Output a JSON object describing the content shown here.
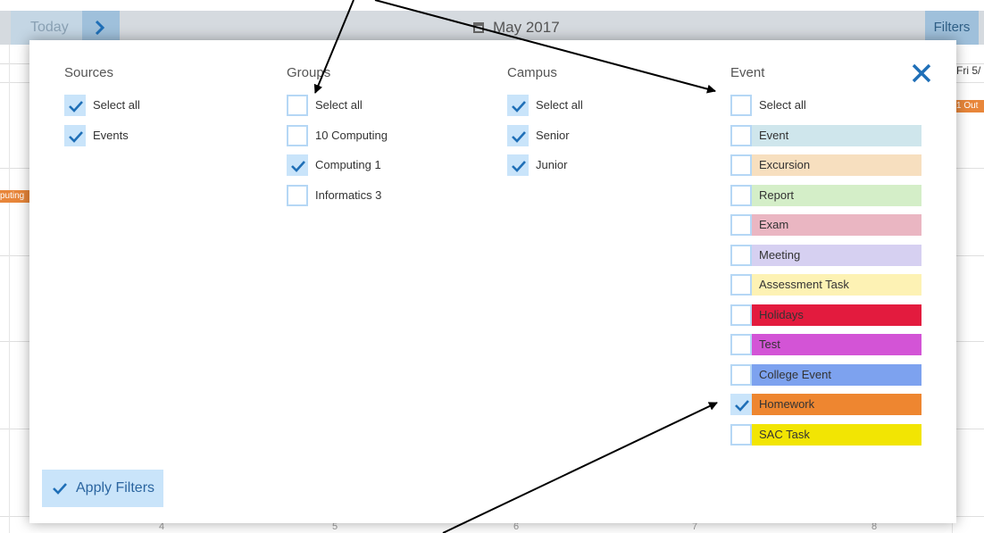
{
  "calendar": {
    "today_label": "Today",
    "month_title": "May 2017",
    "filters_label": "Filters",
    "fri_header": "Fri 5/",
    "chip_right": "1 Out",
    "chip_left": "puting",
    "day_numbers": [
      "4",
      "5",
      "6",
      "7",
      "8"
    ]
  },
  "modal": {
    "apply_label": "Apply Filters",
    "sources": {
      "title": "Sources",
      "options": [
        {
          "label": "Select all",
          "checked": true
        },
        {
          "label": "Events",
          "checked": true
        }
      ]
    },
    "groups": {
      "title": "Groups",
      "options": [
        {
          "label": "Select all",
          "checked": false
        },
        {
          "label": "10 Computing",
          "checked": false
        },
        {
          "label": "Computing 1",
          "checked": true
        },
        {
          "label": "Informatics 3",
          "checked": false
        }
      ]
    },
    "campus": {
      "title": "Campus",
      "options": [
        {
          "label": "Select all",
          "checked": true
        },
        {
          "label": "Senior",
          "checked": true
        },
        {
          "label": "Junior",
          "checked": true
        }
      ]
    },
    "event": {
      "title": "Event",
      "select_all": {
        "label": "Select all",
        "checked": false
      },
      "options": [
        {
          "label": "Event",
          "checked": false,
          "color": "#cfe6ec"
        },
        {
          "label": "Excursion",
          "checked": false,
          "color": "#f7dfbf"
        },
        {
          "label": "Report",
          "checked": false,
          "color": "#d4eec8"
        },
        {
          "label": "Exam",
          "checked": false,
          "color": "#eab6c2"
        },
        {
          "label": "Meeting",
          "checked": false,
          "color": "#d6d0f1"
        },
        {
          "label": "Assessment Task",
          "checked": false,
          "color": "#fdf2b4"
        },
        {
          "label": "Holidays",
          "checked": false,
          "color": "#e31b3e"
        },
        {
          "label": "Test",
          "checked": false,
          "color": "#d354d6"
        },
        {
          "label": "College Event",
          "checked": false,
          "color": "#7da2ef"
        },
        {
          "label": "Homework",
          "checked": true,
          "color": "#ee8630"
        },
        {
          "label": "SAC Task",
          "checked": false,
          "color": "#f2e503"
        }
      ]
    }
  },
  "colors": {
    "accent": "#1f6fb7",
    "checkbox_fill": "#c9e4fa",
    "checkbox_border": "#b5d7f5"
  }
}
